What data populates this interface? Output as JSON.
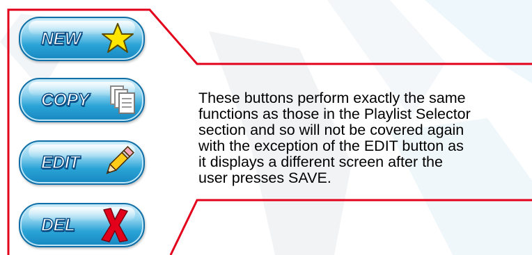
{
  "buttons": [
    {
      "label": "NEW",
      "icon": "star-icon"
    },
    {
      "label": "COPY",
      "icon": "copy-documents-icon"
    },
    {
      "label": "EDIT",
      "icon": "pencil-icon"
    },
    {
      "label": "DEL",
      "icon": "red-x-icon"
    }
  ],
  "description": "These buttons perform exactly the same\nfunctions as those in the Playlist Selector\nsection and so will not be covered again\nwith the exception of the EDIT button as\nit displays a different screen after the\nuser presses SAVE.",
  "colors": {
    "callout_line": "#e3001b",
    "button_blue": "#2aa3d6",
    "button_border": "#0f6fa6",
    "star_yellow": "#ffe600",
    "del_red": "#e3001b"
  }
}
